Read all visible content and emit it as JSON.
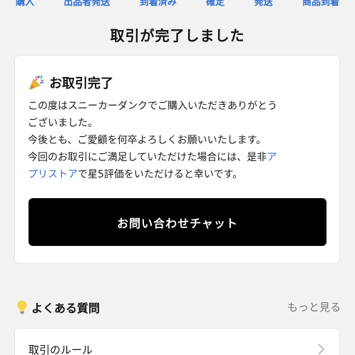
{
  "steps": [
    "購入",
    "出品者発送",
    "到着済み",
    "確定",
    "発送",
    "商品到着"
  ],
  "page_title": "取引が完了しました",
  "card": {
    "heading": "お取引完了",
    "message_lines": [
      "この度はスニーカーダンクでご購入いただきありがとう",
      "ございました。",
      "今後とも、ご愛顧を何卒よろしくお願いいたします。",
      "今回のお取引にご満足していただけた場合には、是非"
    ],
    "link_part1": "ア",
    "link_part2": "プリストア",
    "message_tail": "で星5評価をいただけると幸いです。",
    "chat_button": "お問い合わせチャット"
  },
  "faq": {
    "title": "よくある質問",
    "more": "もっと見る",
    "items": [
      {
        "label": "取引のルール"
      }
    ]
  },
  "colors": {
    "link": "#2f6fd1",
    "button_bg": "#000000",
    "background": "#f2f2f2"
  },
  "icons": {
    "heading_icon": "party-popper-icon",
    "faq_icon": "lightbulb-icon",
    "row_icon": "chevron-right-icon"
  }
}
